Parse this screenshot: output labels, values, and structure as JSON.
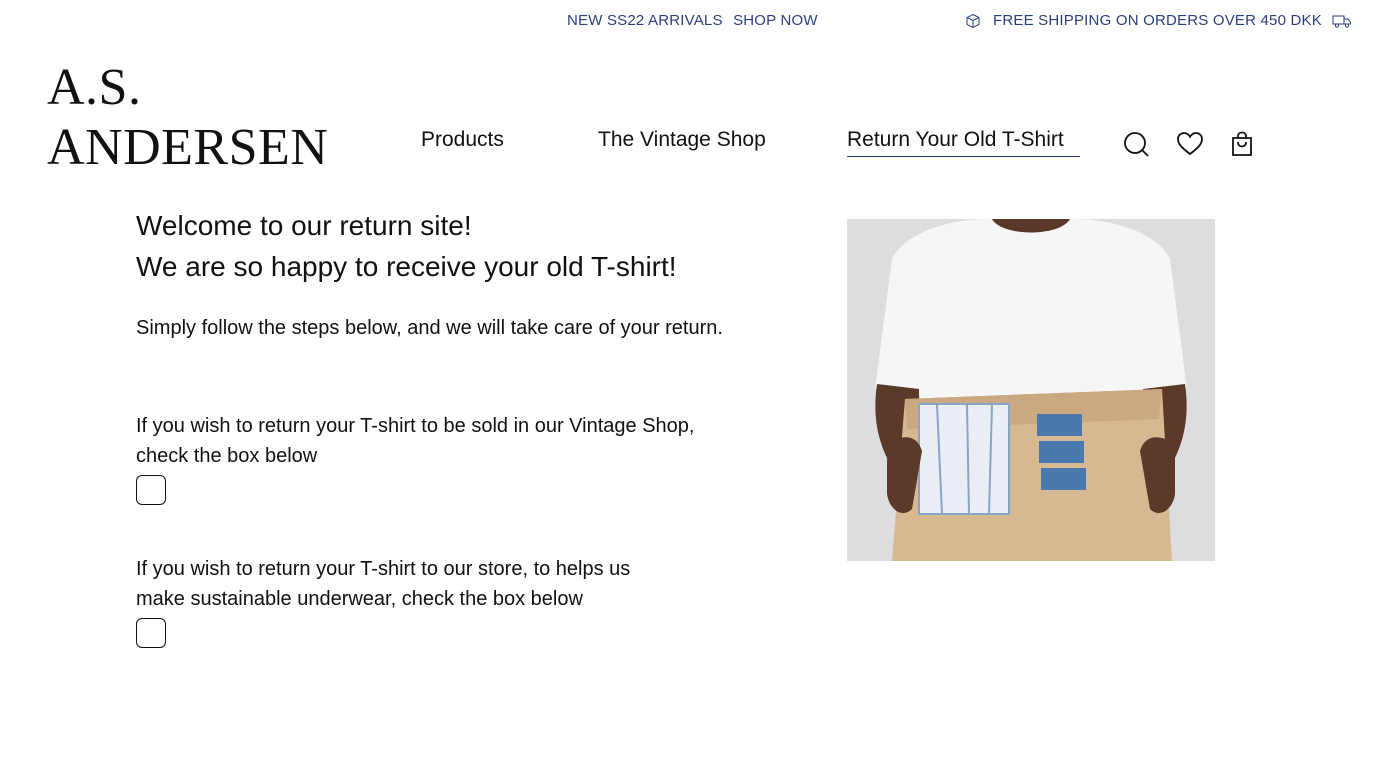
{
  "topbar": {
    "promo_text": "NEW SS22 ARRIVALS",
    "promo_link": "SHOP NOW",
    "shipping_text": "FREE SHIPPING ON ORDERS OVER 450 DKK",
    "text_color": "#2b3f7a"
  },
  "brand": {
    "line1": "A.S.",
    "line2": "ANDERSEN"
  },
  "nav": {
    "items": [
      {
        "label": "Products"
      },
      {
        "label": "The Vintage Shop"
      },
      {
        "label": "Return Your Old T-Shirt",
        "active": true
      }
    ],
    "icons": [
      "search-icon",
      "heart-icon",
      "bag-icon"
    ]
  },
  "main": {
    "welcome_line1": "Welcome to our return site!",
    "welcome_line2": "We are so happy to receive your old T-shirt!",
    "intro": "Simply follow the steps below, and we will take care of your return.",
    "option1_line1": "If you wish to return your T-shirt to be sold in our Vintage Shop,",
    "option1_line2": "check the box below",
    "option2_line1": "If you wish to return your T-shirt to our store, to helps us",
    "option2_line2": "make sustainable underwear, check the box below"
  }
}
